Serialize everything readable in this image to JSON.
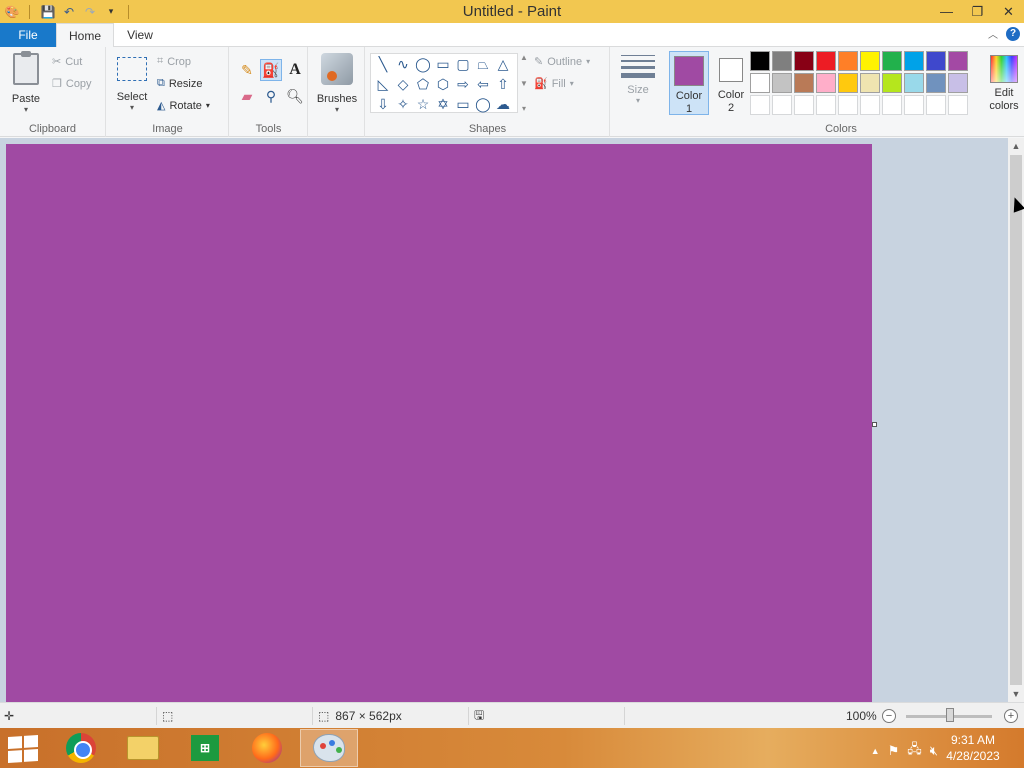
{
  "window": {
    "title": "Untitled - Paint",
    "minimize_label": "—",
    "restore_label": "❐",
    "close_label": "✕"
  },
  "tabs": {
    "file": "File",
    "home": "Home",
    "view": "View",
    "help": "?"
  },
  "clipboard": {
    "paste": "Paste",
    "cut": "Cut",
    "copy": "Copy",
    "label": "Clipboard"
  },
  "image": {
    "select": "Select",
    "crop": "Crop",
    "resize": "Resize",
    "rotate": "Rotate",
    "label": "Image"
  },
  "tools": {
    "label": "Tools",
    "items": [
      "pencil-icon",
      "fill-icon",
      "text-icon",
      "eraser-icon",
      "color-picker-icon",
      "magnifier-icon"
    ]
  },
  "brushes": {
    "label": "Brushes"
  },
  "shapes": {
    "label": "Shapes",
    "outline": "Outline",
    "fill": "Fill"
  },
  "size": {
    "label": "Size"
  },
  "colors": {
    "color1_label": "Color",
    "color1_num": "1",
    "color2_label": "Color",
    "color2_num": "2",
    "edit_label": "Edit",
    "edit_label2": "colors",
    "group_label": "Colors",
    "color1": "#a04aa3",
    "color2": "#ffffff",
    "palette_row1": [
      "#000000",
      "#7f7f7f",
      "#880015",
      "#ed1c24",
      "#ff7f27",
      "#fff200",
      "#22b14c",
      "#00a2e8",
      "#3f48cc",
      "#a349a4"
    ],
    "palette_row2": [
      "#ffffff",
      "#c3c3c3",
      "#b97a57",
      "#ffaec9",
      "#ffc90e",
      "#efe4b0",
      "#b5e61d",
      "#99d9ea",
      "#7092be",
      "#c8bfe7"
    ]
  },
  "canvas": {
    "fill_color": "#a04aa3"
  },
  "status": {
    "dimensions": "867 × 562px",
    "zoom": "100%"
  },
  "taskbar": {
    "time": "9:31 AM",
    "date": "4/28/2023"
  }
}
